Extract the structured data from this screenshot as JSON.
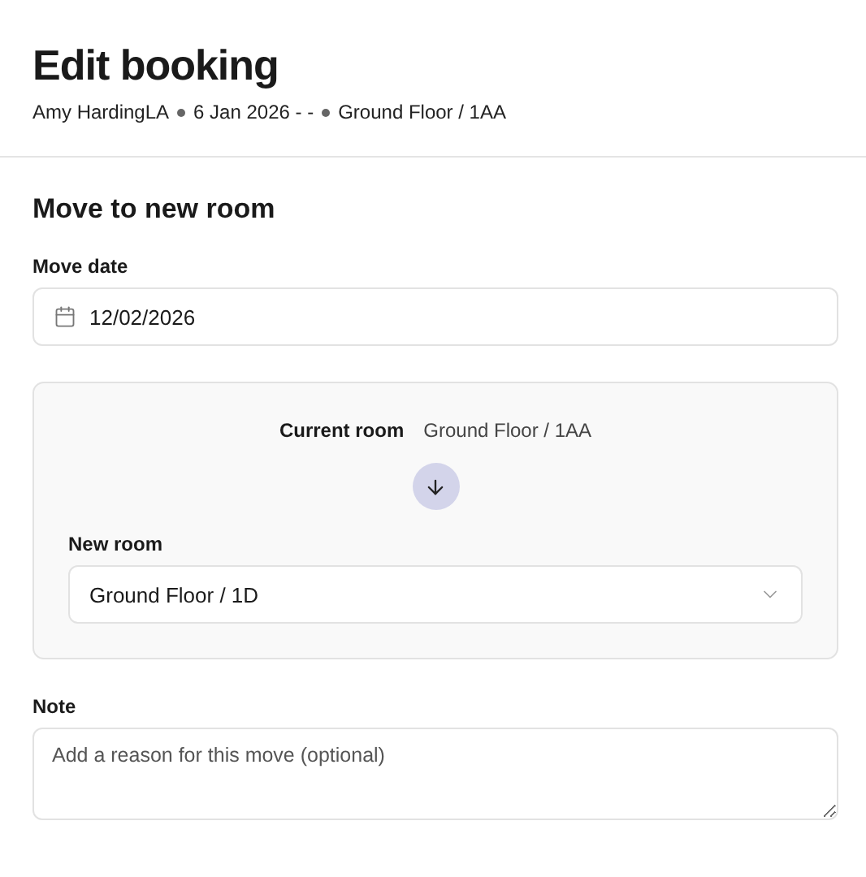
{
  "header": {
    "title": "Edit booking",
    "meta": [
      "Amy HardingLA",
      "6 Jan 2026 - -",
      "Ground Floor / 1AA"
    ]
  },
  "section": {
    "title": "Move to new room"
  },
  "move_date": {
    "label": "Move date",
    "value": "12/02/2026"
  },
  "room_panel": {
    "current_label": "Current room",
    "current_value": "Ground Floor / 1AA",
    "new_label": "New room",
    "new_value": "Ground Floor / 1D"
  },
  "note": {
    "label": "Note",
    "placeholder": "Add a reason for this move (optional)"
  }
}
